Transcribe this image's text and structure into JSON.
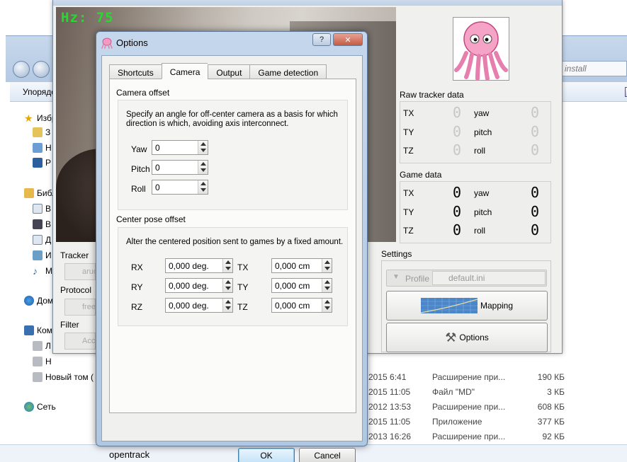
{
  "explorer": {
    "toolbar_label": "Упорядочить",
    "address_text": "install",
    "tree": [
      {
        "label": "Избранное",
        "icon": "star-icon"
      },
      {
        "label": "З",
        "icon": "folder-icon"
      },
      {
        "label": "Н",
        "icon": "desktop-icon"
      },
      {
        "label": "Р",
        "icon": "monitor-icon"
      },
      {
        "label": "Библиотеки",
        "icon": "library-icon"
      },
      {
        "label": "В",
        "icon": "document-icon"
      },
      {
        "label": "В",
        "icon": "video-icon"
      },
      {
        "label": "Д",
        "icon": "document-icon"
      },
      {
        "label": "И",
        "icon": "image-icon"
      },
      {
        "label": "М",
        "icon": "music-icon"
      },
      {
        "label": "Домашняя группа",
        "icon": "homegroup-icon"
      },
      {
        "label": "Компьютер",
        "icon": "computer-icon"
      },
      {
        "label": "Л",
        "icon": "drive-icon"
      },
      {
        "label": "Н",
        "icon": "drive-icon"
      },
      {
        "label": "Новый том (",
        "icon": "drive-icon"
      },
      {
        "label": "Сеть",
        "icon": "network-icon"
      }
    ],
    "files": [
      {
        "date": "2015 6:41",
        "type": "Расширение при...",
        "size": "190 КБ"
      },
      {
        "date": "2015 11:05",
        "type": "Файл \"MD\"",
        "size": "3 КБ"
      },
      {
        "date": "2012 13:53",
        "type": "Расширение при...",
        "size": "608 КБ"
      },
      {
        "date": "2015 11:05",
        "type": "Приложение",
        "size": "377 КБ"
      },
      {
        "date": "2013 16:26",
        "type": "Расширение при...",
        "size": "92 КБ"
      }
    ],
    "status_text": "opentrack"
  },
  "main": {
    "hz_text": "Hz: 75",
    "raw_title": "Raw tracker data",
    "game_title": "Game data",
    "raw_rows": [
      {
        "axis": "TX",
        "value": "0",
        "axis2": "yaw",
        "value2": "0"
      },
      {
        "axis": "TY",
        "value": "0",
        "axis2": "pitch",
        "value2": "0"
      },
      {
        "axis": "TZ",
        "value": "0",
        "axis2": "roll",
        "value2": "0"
      }
    ],
    "game_rows": [
      {
        "axis": "TX",
        "value": "0",
        "axis2": "yaw",
        "value2": "0"
      },
      {
        "axis": "TY",
        "value": "0",
        "axis2": "pitch",
        "value2": "0"
      },
      {
        "axis": "TZ",
        "value": "0",
        "axis2": "roll",
        "value2": "0"
      }
    ],
    "tracker_label": "Tracker",
    "tracker_value": "aruco",
    "protocol_label": "Protocol",
    "protocol_value": "freetrack",
    "filter_label": "Filter",
    "filter_value": "Accela",
    "settings_label": "Settings",
    "profile_label": "Profile",
    "profile_value": "default.ini",
    "mapping_label": "Mapping",
    "options_label": "Options"
  },
  "dialog": {
    "title": "Options",
    "help_btn": "?",
    "close_btn": "✕",
    "tabs": [
      "Shortcuts",
      "Camera",
      "Output",
      "Game detection"
    ],
    "active_tab": "Camera",
    "camera_offset_title": "Camera offset",
    "camera_offset_desc_1": "Specify an angle for off-center camera as a basis for which",
    "camera_offset_desc_2": "direction is which, avoiding axis interconnect.",
    "yaw_label": "Yaw",
    "yaw_value": "0",
    "pitch_label": "Pitch",
    "pitch_value": "0",
    "roll_label": "Roll",
    "roll_value": "0",
    "center_title": "Center pose offset",
    "center_desc": "Alter the centered position sent to games by a fixed amount.",
    "rx_label": "RX",
    "rx_value": "0,000 deg.",
    "ry_label": "RY",
    "ry_value": "0,000 deg.",
    "rz_label": "RZ",
    "rz_value": "0,000 deg.",
    "tx_label": "TX",
    "tx_value": "0,000 cm",
    "ty_label": "TY",
    "ty_value": "0,000 cm",
    "tz_label": "TZ",
    "tz_value": "0,000 cm",
    "ok_label": "OK",
    "cancel_label": "Cancel"
  }
}
